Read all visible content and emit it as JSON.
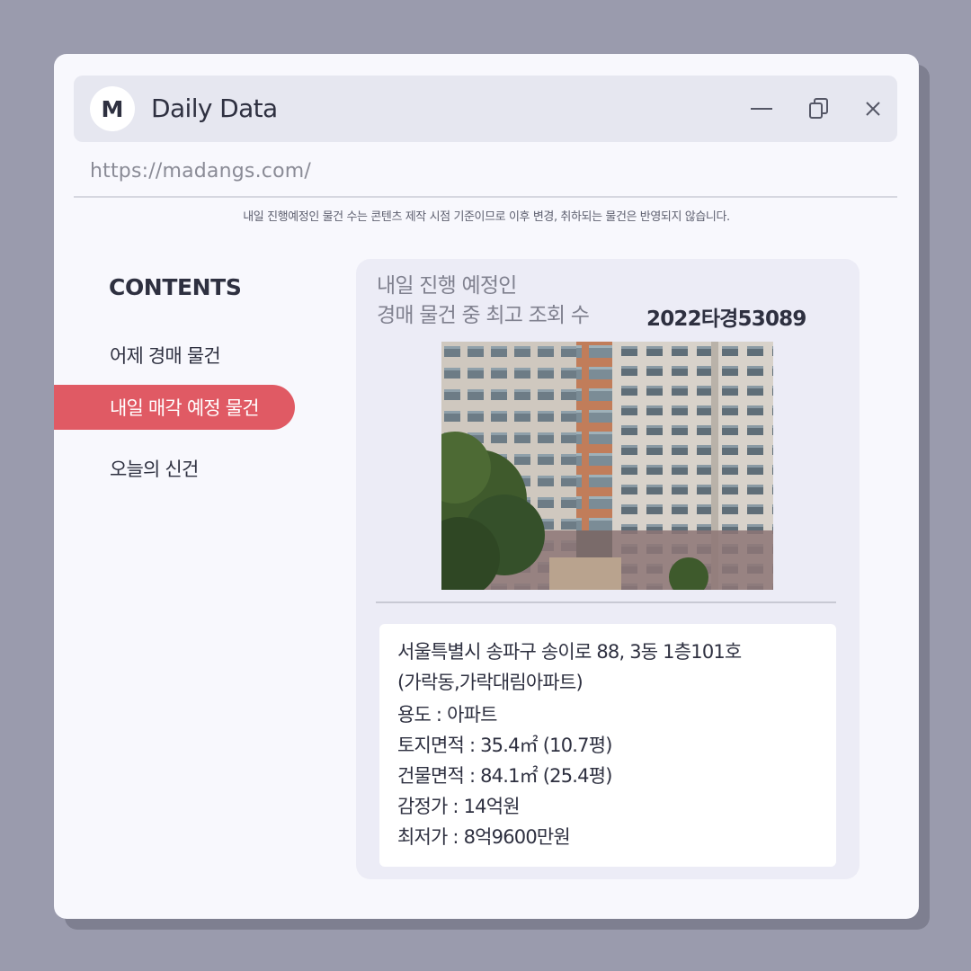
{
  "app": {
    "avatar_letter": "M",
    "title": "Daily Data",
    "url": "https://madangs.com/"
  },
  "window_controls": {
    "minimize_icon": "minimize-icon",
    "restore_icon": "restore-icon",
    "close_icon": "close-icon"
  },
  "notice": "내일 진행예정인 물건 수는 콘텐츠 제작 시점 기준이므로 이후 변경, 취하되는 물건은 반영되지 않습니다.",
  "sidebar": {
    "title": "CONTENTS",
    "items": [
      {
        "label": "어제 경매 물건",
        "active": false
      },
      {
        "label": "내일 매각 예정 물건",
        "active": true
      },
      {
        "label": "오늘의 신건",
        "active": false
      }
    ]
  },
  "card": {
    "label_line1": "내일 진행 예정인",
    "label_line2": "경매 물건 중 최고 조회 수",
    "case_number": "2022타경53089",
    "address_line1": "서울특별시 송파구 송이로 88, 3동 1층101호",
    "address_line2": "(가락동,가락대림아파트)",
    "details": [
      "용도 : 아파트",
      "토지면적 : 35.4㎡ (10.7평)",
      "건물면적 : 84.1㎡ (25.4평)",
      "감정가 : 14억원",
      "최저가 : 8억9600만원"
    ]
  },
  "colors": {
    "background": "#9a9bad",
    "window": "#f8f8fd",
    "titlebar": "#e6e7f0",
    "accent": "#e05a64",
    "card": "#ececf6",
    "text": "#2e3040"
  }
}
